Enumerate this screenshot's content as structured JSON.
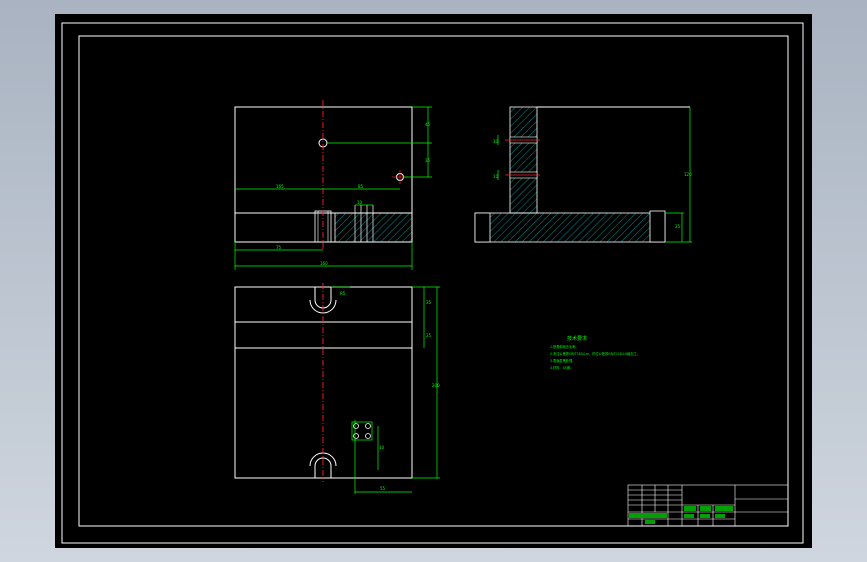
{
  "drawing": {
    "notes": {
      "heading": "技术要求",
      "lines": [
        "1.锐角倒钝去毛刺。",
        "2.未注公差按GB/T1804-m，形位公差按GB/T1184-K级加工。",
        "3.表面发黑处理。",
        "4.材料：45钢。"
      ]
    },
    "colors": {
      "sheet": "#000000",
      "outline": "#ffffff",
      "dimension": "#00ff00",
      "centerline": "#ff2020",
      "hatch": "#00c8c8"
    }
  }
}
